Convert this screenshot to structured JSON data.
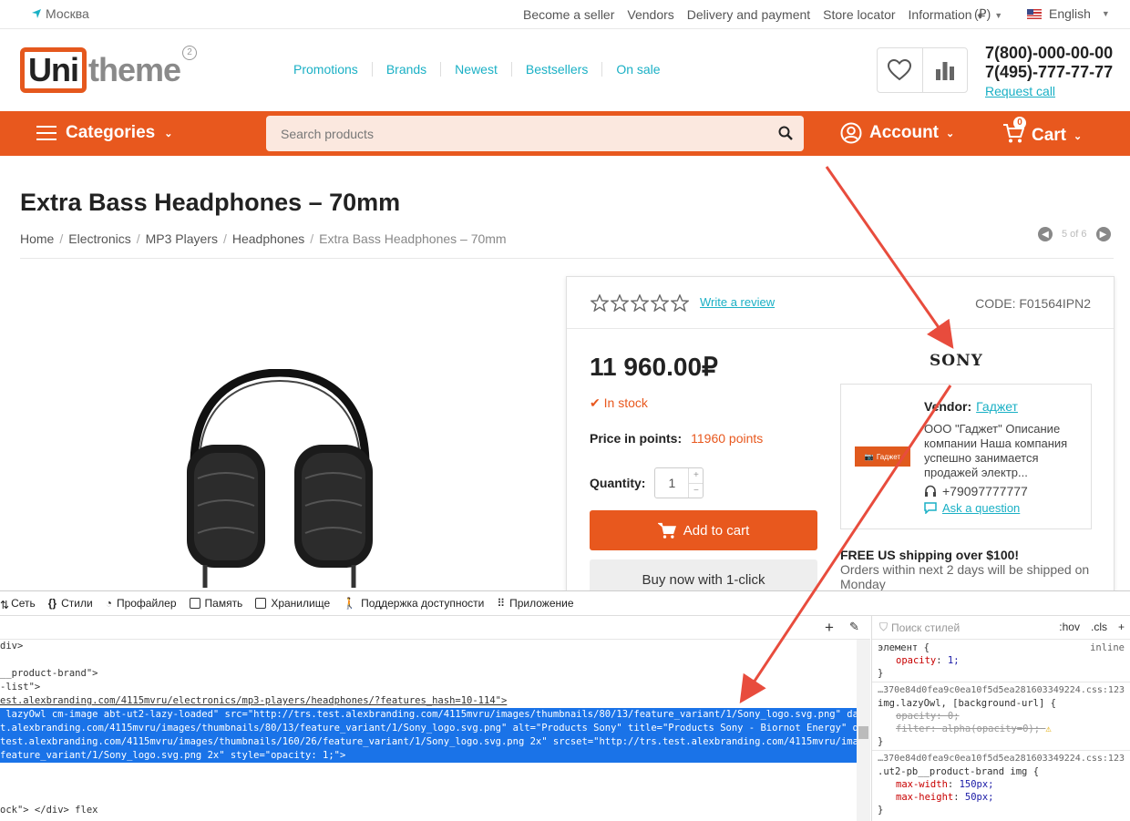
{
  "topbar": {
    "city": "Москва",
    "links": [
      "Become a seller",
      "Vendors",
      "Delivery and payment",
      "Store locator",
      "Information"
    ],
    "currency": "(₽)",
    "language": "English"
  },
  "header": {
    "logo_main": "Uni",
    "logo_rest": "theme",
    "logo_version": "2",
    "nav": [
      "Promotions",
      "Brands",
      "Newest",
      "Bestsellers",
      "On sale"
    ],
    "phone1": "7(800)-000-00-00",
    "phone2": "7(495)-777-77-77",
    "request_call": "Request call"
  },
  "bar": {
    "categories": "Categories",
    "search_placeholder": "Search products",
    "account": "Account",
    "cart": "Cart",
    "cart_count": "0"
  },
  "product": {
    "title": "Extra Bass Headphones – 70mm",
    "breadcrumbs": [
      "Home",
      "Electronics",
      "MP3 Players",
      "Headphones",
      "Extra Bass Headphones – 70mm"
    ],
    "pager": "5 of 6",
    "write_review": "Write a review",
    "code": "CODE:  F01564IPN2",
    "price": "11 960.00",
    "currency_symbol": "₽",
    "stock": "In stock",
    "points_label": "Price in points:",
    "points_value": "11960 points",
    "quantity_label": "Quantity:",
    "quantity_value": "1",
    "add_to_cart": "Add to cart",
    "buy_now": "Buy now with 1-click",
    "brand": "SONY",
    "rating": 0
  },
  "vendor": {
    "label": "Vendor:",
    "name": "Гаджет",
    "logo_text": "Гаджет",
    "description": "ООО \"Гаджет\" Описание компании Наша компания успешно занимается продажей электр...",
    "phone": "+79097777777",
    "ask": "Ask a question"
  },
  "shipping": {
    "title": "FREE US shipping over $100!",
    "text": "Orders within next 2 days will be shipped on Monday"
  },
  "devtools": {
    "tabs": [
      "Сеть",
      "Стили",
      "Профайлер",
      "Память",
      "Хранилище",
      "Поддержка доступности",
      "Приложение"
    ],
    "styles_filter": "Поиск стилей",
    "hov": ":hov",
    "cls": ".cls",
    "code_lines": [
      "div>",
      "",
      "__product-brand\">",
      "-list\">",
      "est.alexbranding.com/4115mvru/electronics/mp3-players/headphones/?features_hash=10-114\">",
      " lazyOwl cm-image abt-ut2-lazy-loaded\" src=\"http://trs.test.alexbranding.com/4115mvru/images/thumbnails/80/13/feature_variant/1/Sony_logo.svg.png\" data-",
      "t.alexbranding.com/4115mvru/images/thumbnails/80/13/feature_variant/1/Sony_logo.svg.png\" alt=\"Products Sony\" title=\"Products Sony - Biornot Energy\" data-",
      "test.alexbranding.com/4115mvru/images/thumbnails/160/26/feature_variant/1/Sony_logo.svg.png 2x\" srcset=\"http://trs.test.alexbranding.com/4115mvru/images",
      "feature_variant/1/Sony_logo.svg.png 2x\" style=\"opacity: 1;\">",
      "",
      "",
      "",
      "ock\"> </div> flex"
    ],
    "rules": [
      {
        "selector": "элемент",
        "source": "inline",
        "props": [
          {
            "name": "opacity",
            "value": "1;"
          }
        ]
      },
      {
        "selector": "img.lazyOwl, [background-url]",
        "source": "…370e84d0fea9c0ea10f5d5ea281603349224.css:123",
        "props": [
          {
            "name": "opacity",
            "value": "0;",
            "strike": true
          },
          {
            "name": "filter",
            "value": "alpha(opacity=0);",
            "strike": true
          }
        ]
      },
      {
        "selector": ".ut2-pb__product-brand img",
        "source": "…370e84d0fea9c0ea10f5d5ea281603349224.css:123",
        "props": [
          {
            "name": "max-width",
            "value": "150px;"
          },
          {
            "name": "max-height",
            "value": "50px;"
          }
        ]
      }
    ]
  },
  "colors": {
    "accent": "#e8581e",
    "link": "#1ab0c5",
    "selection": "#1a73e8",
    "annotation": "#e84c3d"
  }
}
